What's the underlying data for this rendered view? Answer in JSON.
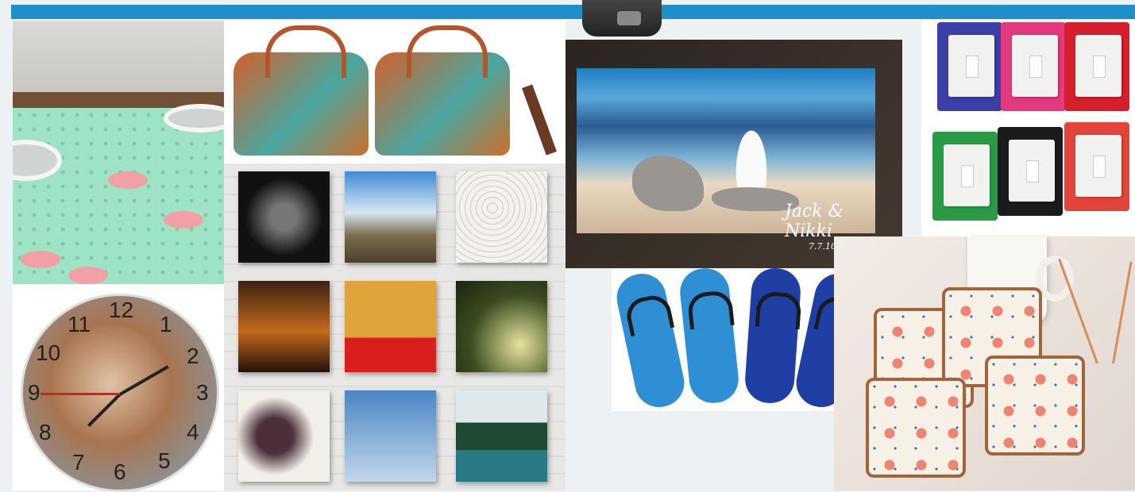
{
  "collage": {
    "signature_name": "Jack & Nikki",
    "signature_date": "7.7.10",
    "clock_numbers": [
      "12",
      "1",
      "2",
      "3",
      "4",
      "5",
      "6",
      "7",
      "8",
      "9",
      "10",
      "11"
    ]
  },
  "products": [
    {
      "name": "table-runner"
    },
    {
      "name": "printed-bags"
    },
    {
      "name": "canvas-wall-tiles"
    },
    {
      "name": "wood-photo-print"
    },
    {
      "name": "light-switch-plates"
    },
    {
      "name": "flip-flops"
    },
    {
      "name": "photo-clock"
    },
    {
      "name": "coasters"
    }
  ],
  "colors": {
    "banner": "#1f8fca",
    "runner_green": "#9fe3c6",
    "switch_colors": [
      "#3b3fa7",
      "#e3397f",
      "#d61f2c",
      "#2a9a46",
      "#1b1b1b",
      "#e2463a"
    ],
    "flop_colors": [
      "#2f8fd5",
      "#2f8fd5",
      "#1f3fa4",
      "#1f3fa4"
    ]
  }
}
